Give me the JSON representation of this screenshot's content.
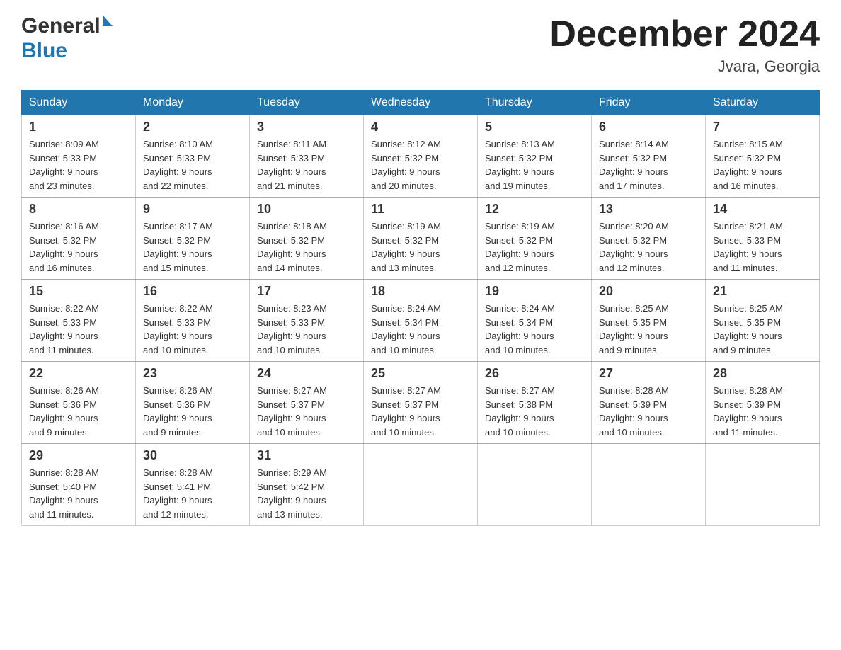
{
  "header": {
    "logo_general": "General",
    "logo_blue": "Blue",
    "month_title": "December 2024",
    "location": "Jvara, Georgia"
  },
  "days_of_week": [
    "Sunday",
    "Monday",
    "Tuesday",
    "Wednesday",
    "Thursday",
    "Friday",
    "Saturday"
  ],
  "weeks": [
    [
      {
        "day": "1",
        "sunrise": "8:09 AM",
        "sunset": "5:33 PM",
        "daylight": "9 hours and 23 minutes."
      },
      {
        "day": "2",
        "sunrise": "8:10 AM",
        "sunset": "5:33 PM",
        "daylight": "9 hours and 22 minutes."
      },
      {
        "day": "3",
        "sunrise": "8:11 AM",
        "sunset": "5:33 PM",
        "daylight": "9 hours and 21 minutes."
      },
      {
        "day": "4",
        "sunrise": "8:12 AM",
        "sunset": "5:32 PM",
        "daylight": "9 hours and 20 minutes."
      },
      {
        "day": "5",
        "sunrise": "8:13 AM",
        "sunset": "5:32 PM",
        "daylight": "9 hours and 19 minutes."
      },
      {
        "day": "6",
        "sunrise": "8:14 AM",
        "sunset": "5:32 PM",
        "daylight": "9 hours and 17 minutes."
      },
      {
        "day": "7",
        "sunrise": "8:15 AM",
        "sunset": "5:32 PM",
        "daylight": "9 hours and 16 minutes."
      }
    ],
    [
      {
        "day": "8",
        "sunrise": "8:16 AM",
        "sunset": "5:32 PM",
        "daylight": "9 hours and 16 minutes."
      },
      {
        "day": "9",
        "sunrise": "8:17 AM",
        "sunset": "5:32 PM",
        "daylight": "9 hours and 15 minutes."
      },
      {
        "day": "10",
        "sunrise": "8:18 AM",
        "sunset": "5:32 PM",
        "daylight": "9 hours and 14 minutes."
      },
      {
        "day": "11",
        "sunrise": "8:19 AM",
        "sunset": "5:32 PM",
        "daylight": "9 hours and 13 minutes."
      },
      {
        "day": "12",
        "sunrise": "8:19 AM",
        "sunset": "5:32 PM",
        "daylight": "9 hours and 12 minutes."
      },
      {
        "day": "13",
        "sunrise": "8:20 AM",
        "sunset": "5:32 PM",
        "daylight": "9 hours and 12 minutes."
      },
      {
        "day": "14",
        "sunrise": "8:21 AM",
        "sunset": "5:33 PM",
        "daylight": "9 hours and 11 minutes."
      }
    ],
    [
      {
        "day": "15",
        "sunrise": "8:22 AM",
        "sunset": "5:33 PM",
        "daylight": "9 hours and 11 minutes."
      },
      {
        "day": "16",
        "sunrise": "8:22 AM",
        "sunset": "5:33 PM",
        "daylight": "9 hours and 10 minutes."
      },
      {
        "day": "17",
        "sunrise": "8:23 AM",
        "sunset": "5:33 PM",
        "daylight": "9 hours and 10 minutes."
      },
      {
        "day": "18",
        "sunrise": "8:24 AM",
        "sunset": "5:34 PM",
        "daylight": "9 hours and 10 minutes."
      },
      {
        "day": "19",
        "sunrise": "8:24 AM",
        "sunset": "5:34 PM",
        "daylight": "9 hours and 10 minutes."
      },
      {
        "day": "20",
        "sunrise": "8:25 AM",
        "sunset": "5:35 PM",
        "daylight": "9 hours and 9 minutes."
      },
      {
        "day": "21",
        "sunrise": "8:25 AM",
        "sunset": "5:35 PM",
        "daylight": "9 hours and 9 minutes."
      }
    ],
    [
      {
        "day": "22",
        "sunrise": "8:26 AM",
        "sunset": "5:36 PM",
        "daylight": "9 hours and 9 minutes."
      },
      {
        "day": "23",
        "sunrise": "8:26 AM",
        "sunset": "5:36 PM",
        "daylight": "9 hours and 9 minutes."
      },
      {
        "day": "24",
        "sunrise": "8:27 AM",
        "sunset": "5:37 PM",
        "daylight": "9 hours and 10 minutes."
      },
      {
        "day": "25",
        "sunrise": "8:27 AM",
        "sunset": "5:37 PM",
        "daylight": "9 hours and 10 minutes."
      },
      {
        "day": "26",
        "sunrise": "8:27 AM",
        "sunset": "5:38 PM",
        "daylight": "9 hours and 10 minutes."
      },
      {
        "day": "27",
        "sunrise": "8:28 AM",
        "sunset": "5:39 PM",
        "daylight": "9 hours and 10 minutes."
      },
      {
        "day": "28",
        "sunrise": "8:28 AM",
        "sunset": "5:39 PM",
        "daylight": "9 hours and 11 minutes."
      }
    ],
    [
      {
        "day": "29",
        "sunrise": "8:28 AM",
        "sunset": "5:40 PM",
        "daylight": "9 hours and 11 minutes."
      },
      {
        "day": "30",
        "sunrise": "8:28 AM",
        "sunset": "5:41 PM",
        "daylight": "9 hours and 12 minutes."
      },
      {
        "day": "31",
        "sunrise": "8:29 AM",
        "sunset": "5:42 PM",
        "daylight": "9 hours and 13 minutes."
      },
      null,
      null,
      null,
      null
    ]
  ],
  "labels": {
    "sunrise": "Sunrise:",
    "sunset": "Sunset:",
    "daylight": "Daylight:"
  }
}
